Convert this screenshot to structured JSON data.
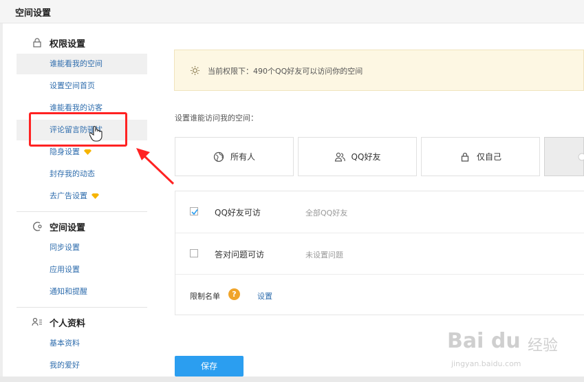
{
  "page": {
    "title": "空间设置"
  },
  "sidebar": {
    "sections": [
      {
        "title": "权限设置",
        "icon": "lock-icon",
        "items": [
          {
            "label": "谁能看我的空间"
          },
          {
            "label": "设置空间首页"
          },
          {
            "label": "谁能看我的访客"
          },
          {
            "label": "评论留言防骚扰"
          },
          {
            "label": "隐身设置",
            "badge": "diamond-icon"
          },
          {
            "label": "封存我的动态"
          },
          {
            "label": "去广告设置",
            "badge": "diamond-icon"
          }
        ]
      },
      {
        "title": "空间设置",
        "icon": "share-icon",
        "items": [
          {
            "label": "同步设置"
          },
          {
            "label": "应用设置"
          },
          {
            "label": "通知和提醒"
          }
        ]
      },
      {
        "title": "个人资料",
        "icon": "user-list-icon",
        "items": [
          {
            "label": "基本资料"
          },
          {
            "label": "我的爱好"
          }
        ]
      }
    ]
  },
  "notice": {
    "text": "当前权限下：490个QQ好友可以访问你的空间",
    "icon": "sun-icon"
  },
  "access": {
    "label": "设置谁能访问我的空间：",
    "options": [
      {
        "label": "所有人",
        "icon": "globe-icon"
      },
      {
        "label": "QQ好友",
        "icon": "friends-icon"
      },
      {
        "label": "仅自己",
        "icon": "lock-icon"
      }
    ]
  },
  "panel": {
    "rows": [
      {
        "label": "QQ好友可访",
        "desc": "全部QQ好友",
        "checked": true
      },
      {
        "label": "答对问题可访",
        "desc": "未设置问题",
        "checked": false
      }
    ],
    "restrict": {
      "label": "限制名单",
      "help": "?",
      "link": "设置"
    }
  },
  "save_label": "保存",
  "watermark": {
    "logo": "Bai du",
    "cn": "经验",
    "url": "jingyan.baidu.com"
  },
  "colors": {
    "link": "#2f6dad",
    "accent": "#2b9ef0",
    "highlight": "#ff2222",
    "notice_bg": "#fdf7e3"
  }
}
